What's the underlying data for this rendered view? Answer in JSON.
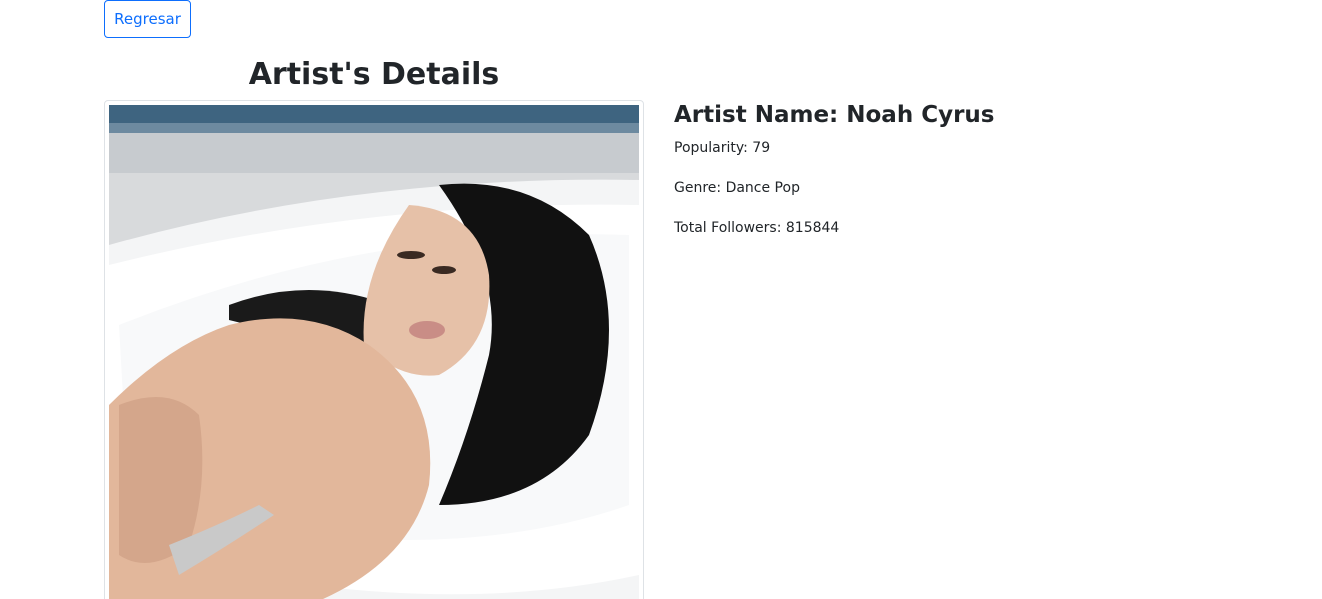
{
  "back_button": {
    "label": "Regresar"
  },
  "page_title": "Artist's Details",
  "artist": {
    "name_line": "Artist Name: Noah Cyrus",
    "popularity_line": "Popularity: 79",
    "genre_line": "Genre: Dance Pop",
    "followers_line": "Total Followers: 815844"
  },
  "colors": {
    "primary": "#0d6efd",
    "text": "#212529",
    "border": "#dee2e6"
  }
}
